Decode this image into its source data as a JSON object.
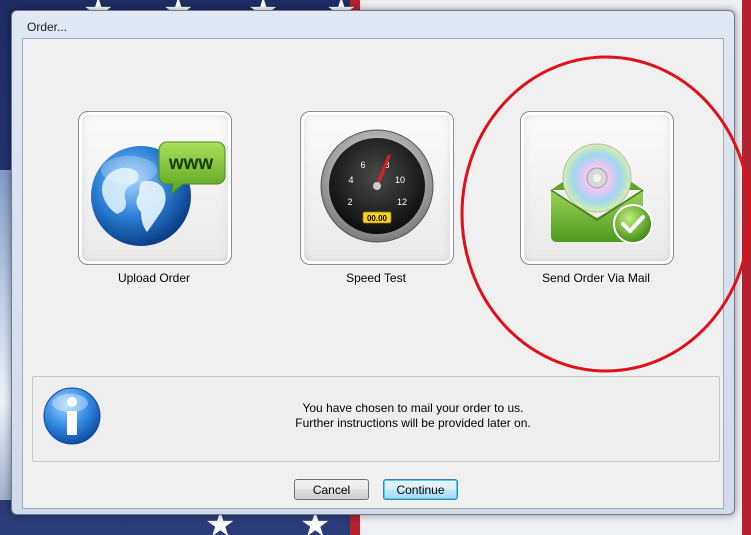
{
  "window": {
    "title": "Order..."
  },
  "options": [
    {
      "label": "Upload Order",
      "icon": "globe-www-icon",
      "bubble_text": "www"
    },
    {
      "label": "Speed Test",
      "icon": "speedometer-icon",
      "gauge_numbers": [
        "2",
        "4",
        "6",
        "8",
        "10",
        "12"
      ],
      "readout": "00.00"
    },
    {
      "label": "Send Order Via Mail",
      "icon": "mail-cd-icon"
    }
  ],
  "info": {
    "icon": "info-icon",
    "line1": "You have chosen to mail your order to us.",
    "line2": "Further instructions will be provided later on."
  },
  "buttons": {
    "cancel": "Cancel",
    "continue": "Continue"
  },
  "colors": {
    "annotation": "#e0101a",
    "accent": "#3c7fb1"
  }
}
